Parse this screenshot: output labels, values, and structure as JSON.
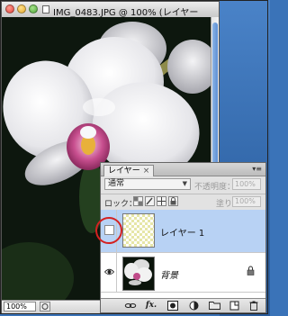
{
  "document_window": {
    "title": "IMG_0483.JPG @ 100% (レイヤー",
    "zoom_level": "100%",
    "icons": [
      "close-button",
      "minimize-button",
      "zoom-button",
      "document-icon",
      "navigate-icon"
    ]
  },
  "layers_panel": {
    "tab_label": "レイヤー",
    "tab_close": "×",
    "menu_glyph": "▾≡",
    "blend_mode": "通常",
    "opacity_label": "不透明度：",
    "opacity_value": "100%",
    "lock_label": "ロック：",
    "fill_label": "塗り：",
    "fill_value": "100%",
    "layers": [
      {
        "name": "レイヤー 1",
        "selected": true,
        "visible": false,
        "thumbnail": "transparent"
      },
      {
        "name": "背景",
        "selected": false,
        "visible": true,
        "thumbnail": "photo",
        "locked": true
      }
    ],
    "bottom_icons": [
      "link-icon",
      "fx-icon",
      "mask-icon",
      "adjustment-icon",
      "group-folder-icon",
      "new-layer-icon",
      "trash-icon"
    ]
  },
  "annotation_color": "#d42121",
  "selection_color": "#b8d2f4"
}
